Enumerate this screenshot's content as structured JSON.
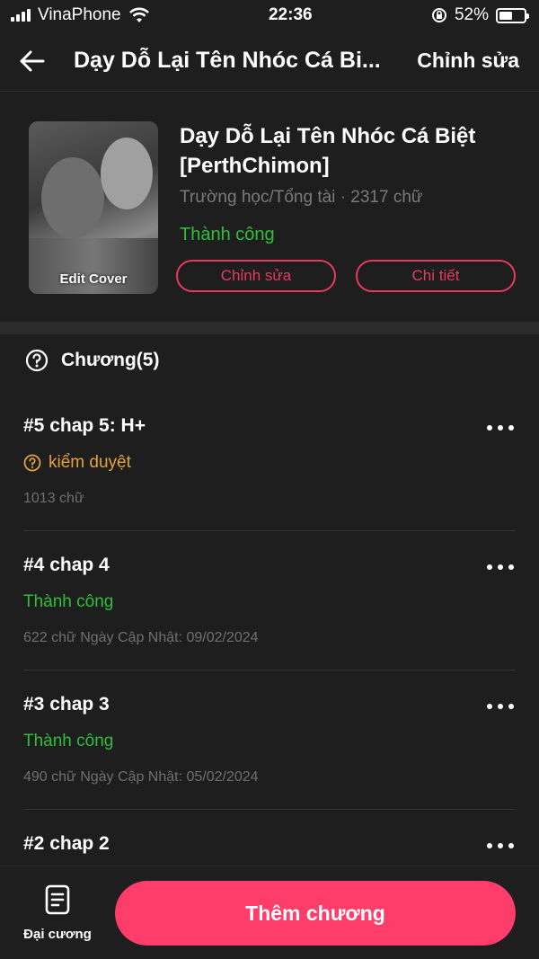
{
  "status_bar": {
    "carrier": "VinaPhone",
    "time": "22:36",
    "battery": "52%",
    "battery_level": 0.52
  },
  "nav": {
    "title": "Dạy Dỗ Lại Tên Nhóc Cá Bi...",
    "edit_label": "Chỉnh sửa"
  },
  "book": {
    "cover_label": "Edit Cover",
    "title": "Dạy Dỗ Lại Tên Nhóc Cá Biệt [PerthChimon]",
    "meta": "Trường học/Tổng tài · 2317 chữ",
    "status": "Thành công",
    "edit_button": "Chỉnh sửa",
    "detail_button": "Chi tiết"
  },
  "chapters_header": "Chương(5)",
  "chapters": [
    {
      "title": "#5 chap 5: H+",
      "status": "kiểm duyệt",
      "meta": "1013 chữ"
    },
    {
      "title": "#4 chap 4",
      "status": "Thành công",
      "meta": "622 chữ Ngày Cập Nhật: 09/02/2024"
    },
    {
      "title": "#3 chap 3",
      "status": "Thành công",
      "meta": "490 chữ Ngày Cập Nhật: 05/02/2024"
    },
    {
      "title": "#2 chap 2"
    }
  ],
  "bottom": {
    "outline_label": "Đại cương",
    "add_chapter": "Thêm chương"
  },
  "colors": {
    "accent": "#ff3d6a",
    "success": "#2fbf3a",
    "warning": "#e5a23a",
    "background": "#1e1e1e"
  }
}
